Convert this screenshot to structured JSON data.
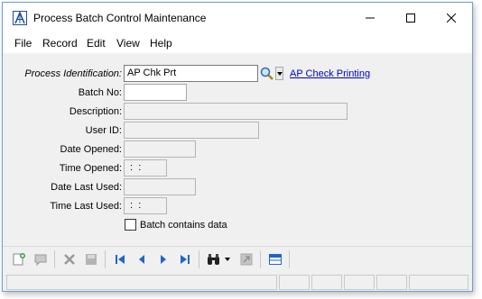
{
  "window": {
    "title": "Process Batch Control Maintenance",
    "icons": {
      "app": "abs-logo-icon",
      "minimize": "minimize-icon",
      "maximize": "maximize-icon",
      "close": "close-icon"
    }
  },
  "menu": [
    "File",
    "Record",
    "Edit",
    "View",
    "Help"
  ],
  "form": {
    "process_id": {
      "label": "Process Identification:",
      "value": "AP Chk Prt",
      "link": "AP Check Printing"
    },
    "batch_no": {
      "label": "Batch No:",
      "value": ""
    },
    "description": {
      "label": "Description:",
      "value": ""
    },
    "user_id": {
      "label": "User ID:",
      "value": ""
    },
    "date_opened": {
      "label": "Date Opened:",
      "value": ""
    },
    "time_opened": {
      "label": "Time Opened:",
      "value": " :  :"
    },
    "date_last_used": {
      "label": "Date Last Used:",
      "value": ""
    },
    "time_last_used": {
      "label": "Time Last Used:",
      "value": " :  :"
    },
    "batch_contains_data": {
      "label": "Batch contains data",
      "checked": false
    }
  },
  "toolbar": [
    "new-record-icon",
    "notes-icon",
    "delete-icon",
    "save-icon",
    "first-record-icon",
    "previous-record-icon",
    "next-record-icon",
    "last-record-icon",
    "find-icon",
    "find-dropdown-icon",
    "export-icon",
    "layout-icon"
  ],
  "colors": {
    "accent": "#1f4ea3",
    "link": "#0000cc",
    "window_border": "#6f9dd6",
    "background": "#f0f0f0"
  }
}
